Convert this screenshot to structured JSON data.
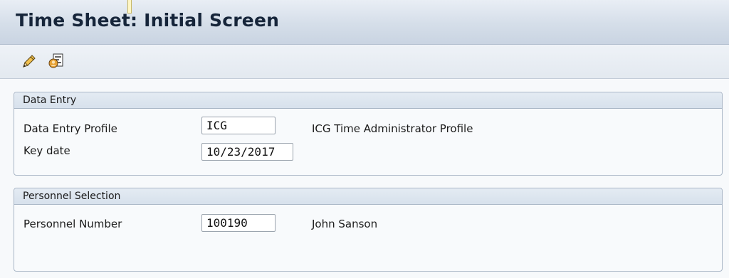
{
  "window": {
    "title": "Time Sheet: Initial Screen"
  },
  "toolbar": {
    "icons": [
      "pencil-icon",
      "profile-settings-icon"
    ]
  },
  "data_entry": {
    "title": "Data Entry",
    "profile_label": "Data Entry Profile",
    "profile_value": "ICG",
    "profile_desc": "ICG Time Administrator Profile",
    "keydate_label": "Key date",
    "keydate_value": "10/23/2017"
  },
  "personnel": {
    "title": "Personnel Selection",
    "number_label": "Personnel Number",
    "number_value": "100190",
    "name": "John Sanson"
  },
  "colors": {
    "title_text": "#16253a",
    "frame": "#a9b6c6",
    "header_bg": "#d5dee9"
  }
}
